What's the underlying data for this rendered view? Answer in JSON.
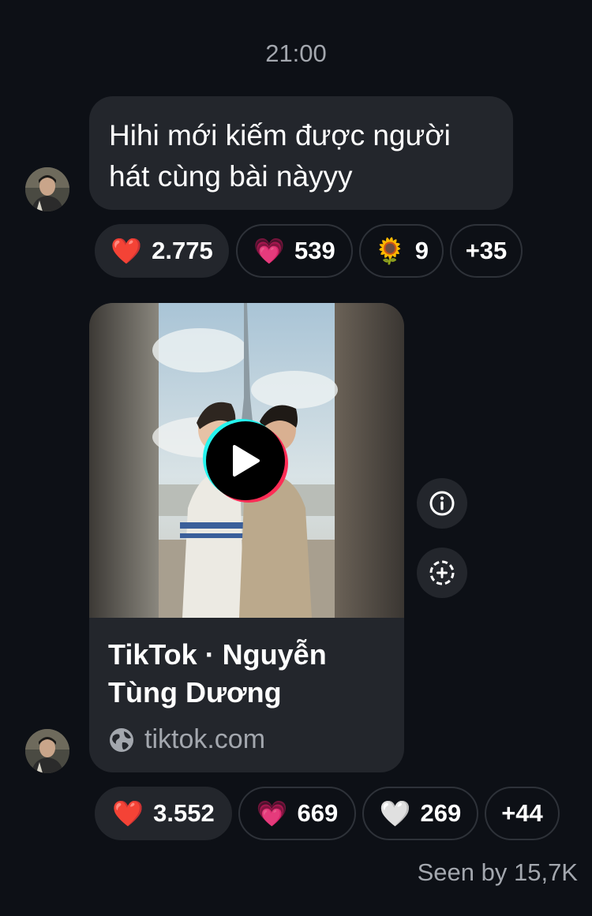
{
  "timestamp": "21:00",
  "message": {
    "text": "Hihi mới kiếm được người hát cùng bài nàyyy",
    "reactions": [
      {
        "emoji": "❤️",
        "count": "2.775",
        "active": true
      },
      {
        "emoji": "💗",
        "count": "539"
      },
      {
        "emoji": "🌻",
        "count": "9"
      },
      {
        "more": "+35"
      }
    ]
  },
  "link_card": {
    "title": "TikTok · Nguyễn Tùng Dương",
    "domain": "tiktok.com",
    "icons": {
      "play": "play-icon",
      "globe": "globe-icon",
      "info": "info-icon",
      "add": "add-reaction-icon"
    },
    "reactions": [
      {
        "emoji": "❤️",
        "count": "3.552",
        "active": true
      },
      {
        "emoji": "💗",
        "count": "669"
      },
      {
        "emoji": "🤍",
        "count": "269"
      },
      {
        "more": "+44"
      }
    ]
  },
  "seen_text": "Seen by 15,7K",
  "colors": {
    "background": "#0d1016",
    "bubble": "#23262c",
    "muted_text": "#a3a7ae",
    "tiktok_cyan": "#25f4ee",
    "tiktok_red": "#fe2c55"
  }
}
